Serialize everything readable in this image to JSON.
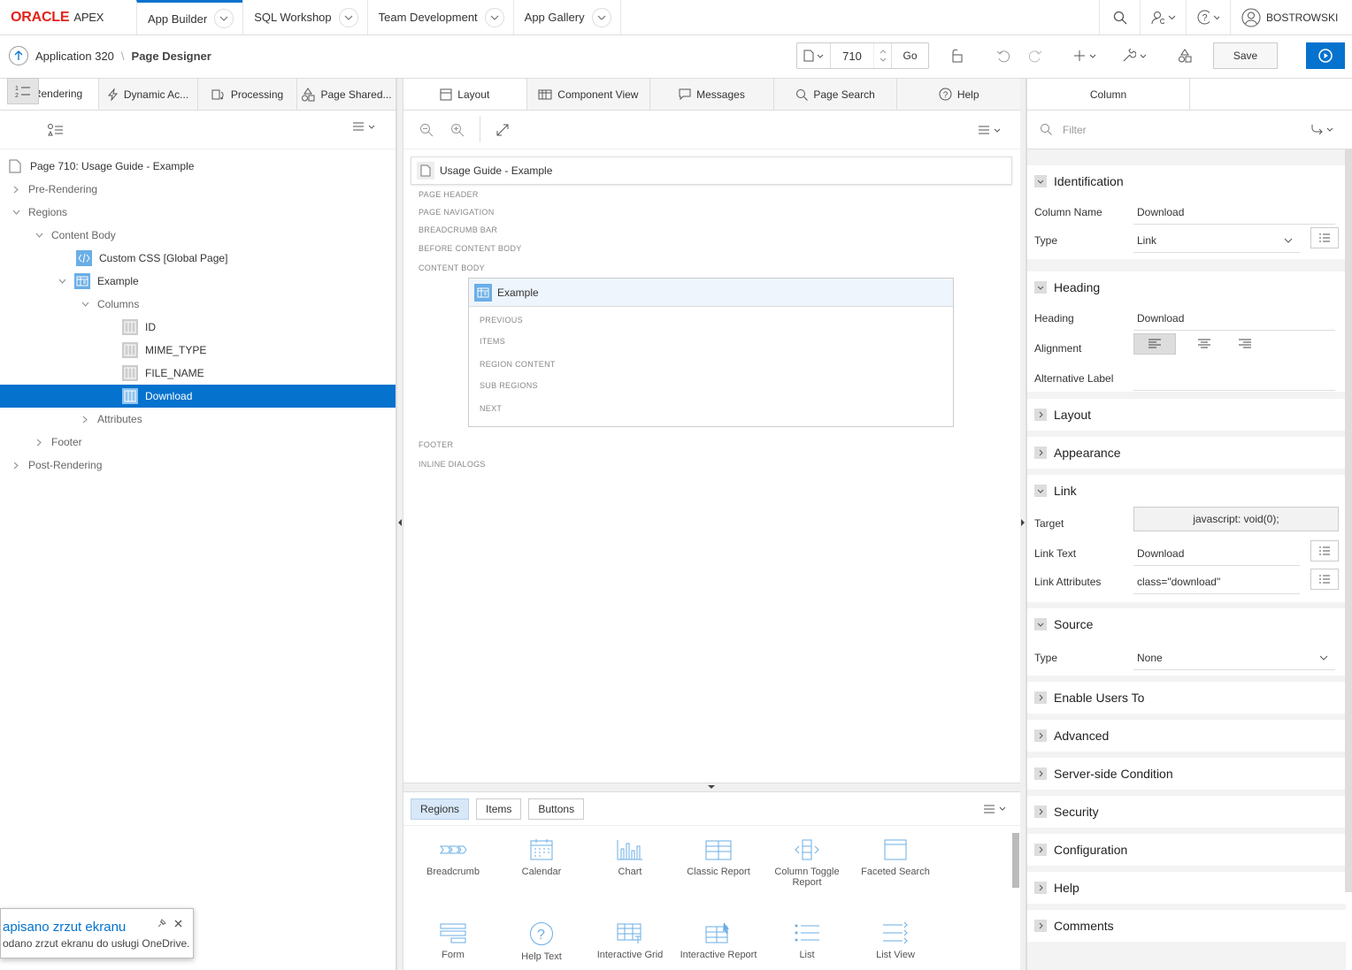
{
  "brand": {
    "oracle": "ORACLE",
    "apex": "APEX"
  },
  "top_nav": {
    "tabs": [
      "App Builder",
      "SQL Workshop",
      "Team Development",
      "App Gallery"
    ],
    "user": "BOSTROWSKI"
  },
  "toolbar": {
    "application": "Application 320",
    "page_designer": "Page Designer",
    "page_number": "710",
    "go_label": "Go",
    "save_label": "Save"
  },
  "left_tabs": [
    "Rendering",
    "Dynamic Ac...",
    "Processing",
    "Page Shared..."
  ],
  "tree": {
    "page": "Page 710: Usage Guide - Example",
    "pre_rendering": "Pre-Rendering",
    "regions": "Regions",
    "content_body": "Content Body",
    "custom_css": "Custom CSS [Global Page]",
    "example": "Example",
    "columns": "Columns",
    "col_id": "ID",
    "col_mime": "MIME_TYPE",
    "col_file": "FILE_NAME",
    "col_download": "Download",
    "attributes": "Attributes",
    "footer": "Footer",
    "post_rendering": "Post-Rendering"
  },
  "mid_tabs": [
    "Layout",
    "Component View",
    "Messages",
    "Page Search",
    "Help"
  ],
  "layout": {
    "page_title": "Usage Guide - Example",
    "slots": [
      "PAGE HEADER",
      "PAGE NAVIGATION",
      "BREADCRUMB BAR",
      "BEFORE CONTENT BODY",
      "CONTENT BODY"
    ],
    "region_title": "Example",
    "region_slots": [
      "PREVIOUS",
      "ITEMS",
      "REGION CONTENT",
      "SUB REGIONS",
      "NEXT"
    ],
    "bottom_slots": [
      "FOOTER",
      "INLINE DIALOGS"
    ]
  },
  "gallery": {
    "tabs": [
      "Regions",
      "Items",
      "Buttons"
    ],
    "row1": [
      "Breadcrumb",
      "Calendar",
      "Chart",
      "Classic Report",
      "Column Toggle Report",
      "Faceted Search"
    ],
    "row2": [
      "Form",
      "Help Text",
      "Interactive Grid",
      "Interactive Report",
      "List",
      "List View"
    ]
  },
  "right": {
    "tab": "Column",
    "filter_placeholder": "Filter",
    "identification": "Identification",
    "column_name_label": "Column Name",
    "column_name": "Download",
    "type_label": "Type",
    "type": "Link",
    "heading_group": "Heading",
    "heading_label": "Heading",
    "heading": "Download",
    "alignment_label": "Alignment",
    "alt_label": "Alternative Label",
    "layout": "Layout",
    "appearance": "Appearance",
    "link": "Link",
    "target_label": "Target",
    "target": "javascript: void(0);",
    "link_text_label": "Link Text",
    "link_text": "Download",
    "link_attr_label": "Link Attributes",
    "link_attr": "class=\"download\"",
    "source": "Source",
    "source_type_label": "Type",
    "source_type": "None",
    "enable_users": "Enable Users To",
    "advanced": "Advanced",
    "server_cond": "Server-side Condition",
    "security": "Security",
    "configuration": "Configuration",
    "help": "Help",
    "comments": "Comments"
  },
  "toast": {
    "title": "apisano zrzut ekranu",
    "body": "odano zrzut ekranu do usługi OneDrive."
  },
  "colors": {
    "accent": "#0572ce",
    "oracle_red": "#e2231a"
  }
}
